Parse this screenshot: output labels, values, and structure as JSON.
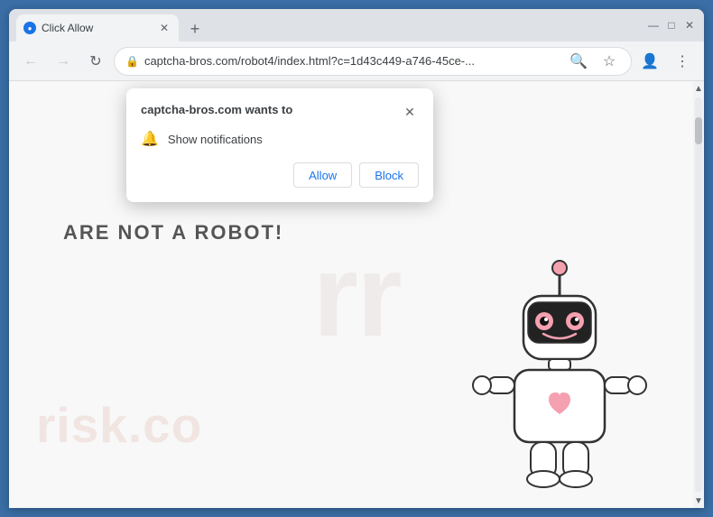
{
  "browser": {
    "title_bar": {
      "tab_title": "Click Allow",
      "new_tab_label": "+",
      "window_minimize": "—",
      "window_maximize": "□",
      "window_close": "✕"
    },
    "toolbar": {
      "back_icon": "←",
      "forward_icon": "→",
      "reload_icon": "↻",
      "url": "captcha-bros.com/robot4/index.html?c=1d43c449-a746-45ce-...",
      "search_icon": "🔍",
      "bookmark_icon": "☆",
      "profile_icon": "👤",
      "menu_icon": "⋮"
    },
    "page": {
      "watermark_large": "rr",
      "watermark_bottom": "risk.co",
      "heading": "ARE NOT A ROBOT!"
    },
    "popup": {
      "title": "captcha-bros.com wants to",
      "close_icon": "✕",
      "notification_label": "Show notifications",
      "allow_button": "Allow",
      "block_button": "Block"
    }
  }
}
